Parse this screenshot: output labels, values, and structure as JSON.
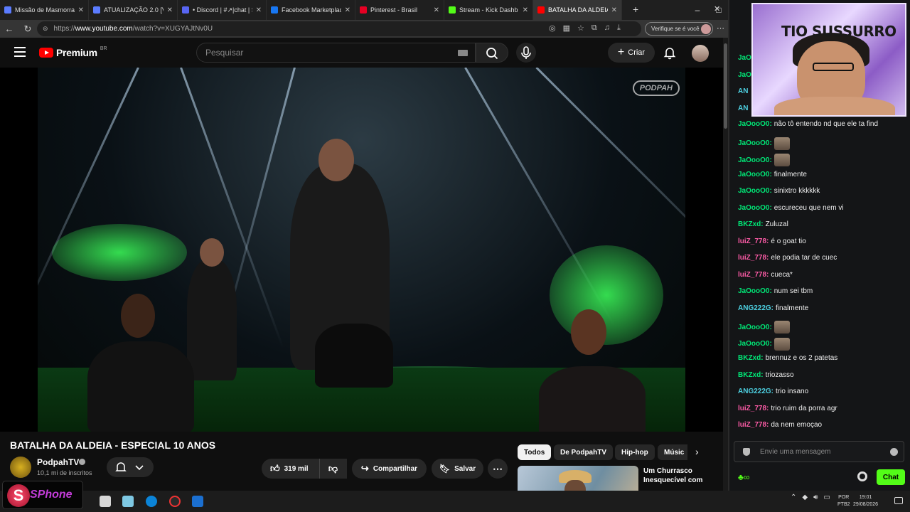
{
  "browser": {
    "tabs": [
      {
        "title": "Missão de Masmorras R",
        "color": "#5b7cff"
      },
      {
        "title": "ATUALIZAÇÃO 2.0 [VERÃ",
        "color": "#5b7cff"
      },
      {
        "title": "• Discord | #↗|chat | S",
        "color": "#5865f2"
      },
      {
        "title": "Facebook Marketplace |",
        "color": "#1877f2"
      },
      {
        "title": "Pinterest - Brasil",
        "color": "#e60023"
      },
      {
        "title": "Stream - Kick Dashb",
        "color": "#53fc18"
      },
      {
        "title": "BATALHA DA ALDEIA",
        "color": "#ff0000"
      }
    ],
    "new_tab": "+",
    "window_buttons": [
      "–",
      "□",
      "✕"
    ],
    "url_prefix": "https://",
    "url_host": "www.youtube.com",
    "url_path": "/watch?v=XUGYAJtNv0U",
    "verify_label": "Verifique se é você"
  },
  "youtube": {
    "logo": "Premium",
    "country": "BR",
    "search_placeholder": "Pesquisar",
    "create_label": "Criar",
    "watermark": "PODPAH",
    "video_title": "BATALHA DA ALDEIA - ESPECIAL 10 ANOS",
    "channel_name": "PodpahTV",
    "subscribers": "10,1 mi de inscritos",
    "like_count": "319 mil",
    "share_label": "Compartilhar",
    "save_label": "Salvar",
    "chips": [
      "Todos",
      "De PodpahTV",
      "Hip-hop",
      "Músic"
    ],
    "recommended_title": "Um Churrasco Inesquecível com"
  },
  "chat": {
    "peek_users": [
      "JaO",
      "JaO",
      "AN",
      "AN"
    ],
    "messages": [
      {
        "user": "JaOooO0:",
        "text": "não tô entendo nd que ele ta find",
        "color": "#00e676",
        "emote": false
      },
      {
        "user": "JaOooO0:",
        "text": "",
        "color": "#00e676",
        "emote": true
      },
      {
        "user": "JaOooO0:",
        "text": "",
        "color": "#00e676",
        "emote": true
      },
      {
        "user": "JaOooO0:",
        "text": "finalmente",
        "color": "#00e676",
        "emote": false
      },
      {
        "user": "JaOooO0:",
        "text": "sinixtro kkkkkk",
        "color": "#00e676",
        "emote": false
      },
      {
        "user": "JaOooO0:",
        "text": "escureceu que nem vi",
        "color": "#00e676",
        "emote": false
      },
      {
        "user": "BKZxd:",
        "text": "Zuluzal",
        "color": "#00e676",
        "emote": false
      },
      {
        "user": "luiZ_778:",
        "text": "é o goat tio",
        "color": "#ff5ca8",
        "emote": false
      },
      {
        "user": "luiZ_778:",
        "text": "ele podia tar de cuec",
        "color": "#ff5ca8",
        "emote": false
      },
      {
        "user": "luiZ_778:",
        "text": "cueca*",
        "color": "#ff5ca8",
        "emote": false
      },
      {
        "user": "JaOooO0:",
        "text": "num sei tbm",
        "color": "#00e676",
        "emote": false
      },
      {
        "user": "ANG222G:",
        "text": "finalmente",
        "color": "#4dd0e1",
        "emote": false
      },
      {
        "user": "JaOooO0:",
        "text": "",
        "color": "#00e676",
        "emote": true
      },
      {
        "user": "JaOooO0:",
        "text": "",
        "color": "#00e676",
        "emote": true
      },
      {
        "user": "BKZxd:",
        "text": "brennuz e os 2 patetas",
        "color": "#00e676",
        "emote": false
      },
      {
        "user": "BKZxd:",
        "text": "triozasso",
        "color": "#00e676",
        "emote": false
      },
      {
        "user": "ANG222G:",
        "text": "trio insano",
        "color": "#4dd0e1",
        "emote": false
      },
      {
        "user": "luiZ_778:",
        "text": "trio ruim da porra agr",
        "color": "#ff5ca8",
        "emote": false
      },
      {
        "user": "luiZ_778:",
        "text": "da nem emoçao",
        "color": "#ff5ca8",
        "emote": false
      }
    ],
    "input_placeholder": "Envie uma mensagem",
    "send_label": "Chat",
    "accent": "#53fc18"
  },
  "webcam": {
    "title": "TIO SUSSURRO"
  },
  "overlay": {
    "logo_letter": "S",
    "logo_text": "SPhone"
  },
  "taskbar": {
    "lang_line1": "POR",
    "lang_line2": "PTB2",
    "time": "19:01",
    "date": "29/08/2026"
  }
}
